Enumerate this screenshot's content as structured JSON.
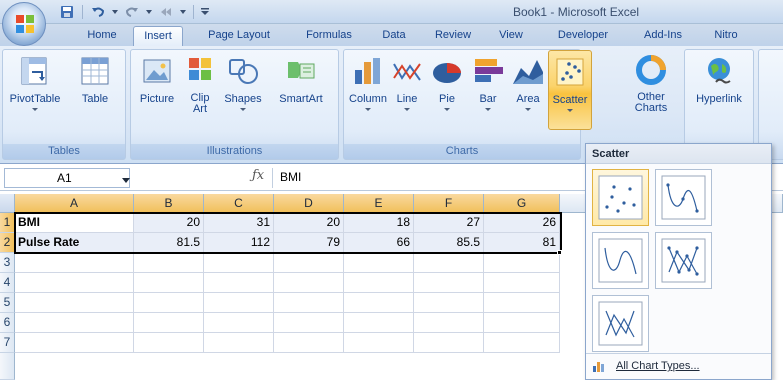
{
  "window": {
    "title": "Book1 - Microsoft Excel"
  },
  "tabs": [
    "Home",
    "Insert",
    "Page Layout",
    "Formulas",
    "Data",
    "Review",
    "View",
    "Developer",
    "Add-Ins",
    "Nitro"
  ],
  "active_tab": "Insert",
  "ribbon": {
    "groups": {
      "tables": {
        "label": "Tables",
        "buttons": [
          "PivotTable",
          "Table"
        ]
      },
      "illustrations": {
        "label": "Illustrations",
        "buttons": [
          "Picture",
          "Clip Art",
          "Shapes",
          "SmartArt"
        ]
      },
      "charts": {
        "label": "Charts",
        "buttons": [
          "Column",
          "Line",
          "Pie",
          "Bar",
          "Area",
          "Scatter",
          "Other Charts"
        ]
      },
      "links": {
        "buttons": [
          "Hyperlink"
        ]
      }
    },
    "clip_art": {
      "line1": "Clip",
      "line2": "Art"
    },
    "other_charts": {
      "line1": "Other",
      "line2": "Charts"
    }
  },
  "formula_bar": {
    "name_box": "A1",
    "fx": "fx",
    "value": "BMI"
  },
  "sheet": {
    "columns": [
      "A",
      "B",
      "C",
      "D",
      "E",
      "F",
      "G"
    ],
    "rows": [
      "1",
      "2",
      "3",
      "4",
      "5",
      "6",
      "7"
    ],
    "data": [
      [
        "BMI",
        "20",
        "31",
        "20",
        "18",
        "27",
        "26"
      ],
      [
        "Pulse Rate",
        "81.5",
        "112",
        "79",
        "66",
        "85.5",
        "81"
      ]
    ]
  },
  "scatter_gallery": {
    "title": "Scatter",
    "items": [
      "scatter-markers-only",
      "scatter-smooth-lines-markers",
      "scatter-smooth-lines",
      "scatter-straight-lines-markers",
      "scatter-straight-lines"
    ],
    "footer": "All Chart Types..."
  },
  "colors": {
    "accent": "#15428b",
    "ribbon_bg": "#dbe7f6",
    "active_button": "#fbd36b",
    "selected_header": "#f1c05c"
  }
}
